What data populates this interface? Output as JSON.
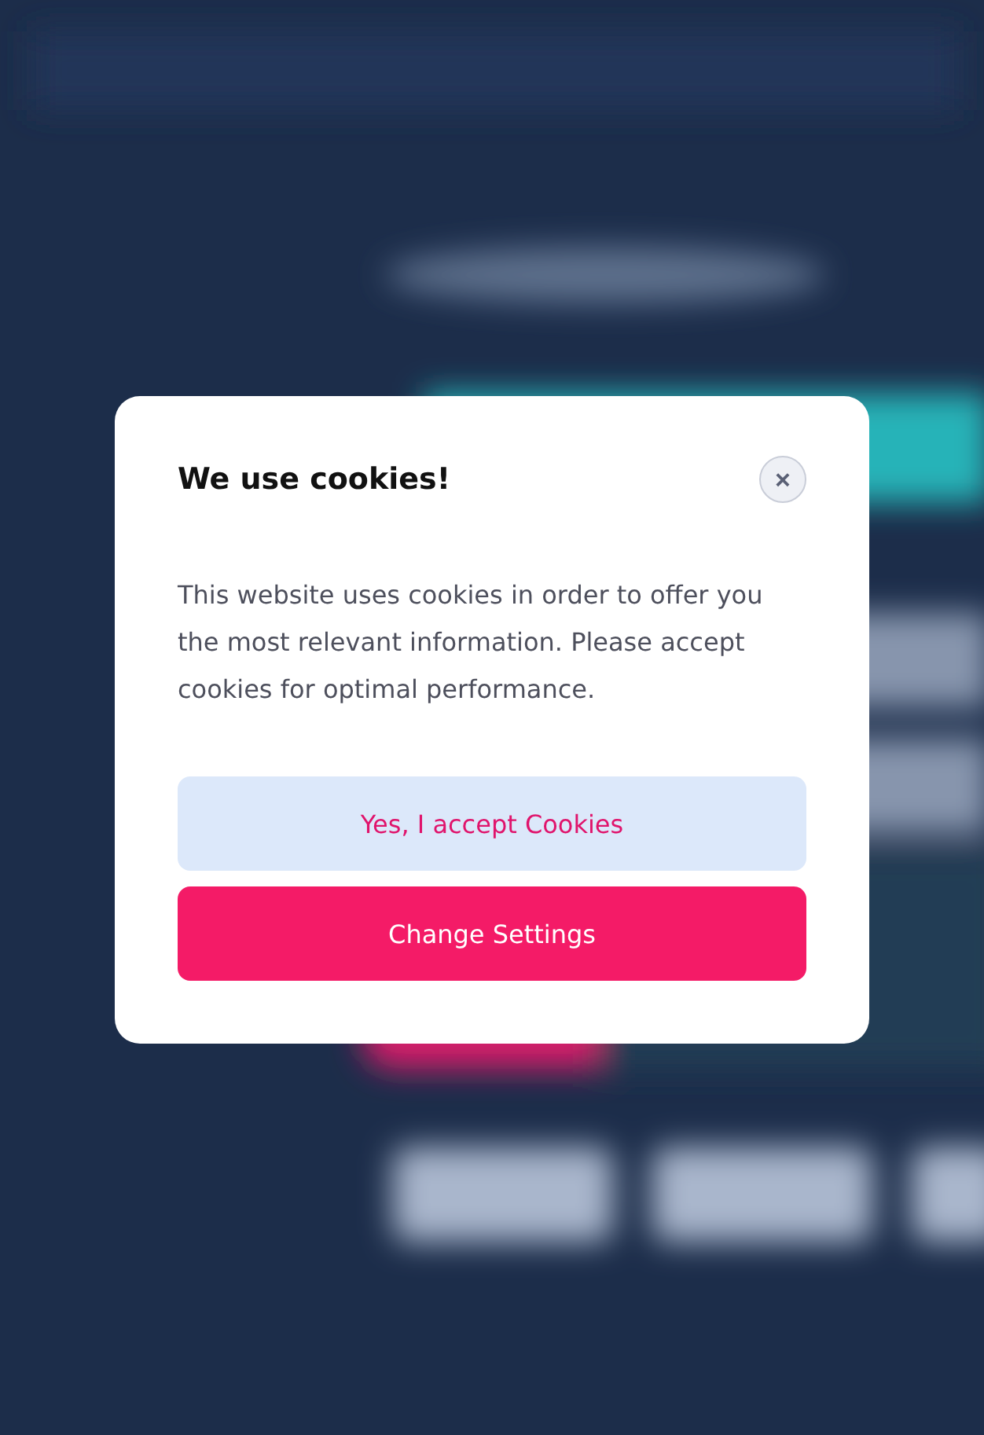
{
  "dialog": {
    "title": "We use cookies!",
    "close_label": "×",
    "message": "This website uses cookies in order to offer you the most relevant information. Please accept cookies for optimal performance.",
    "buttons": [
      {
        "label": "Yes, I accept Cookies",
        "kind": "secondary"
      },
      {
        "label": "Change Settings",
        "kind": "primary"
      }
    ]
  }
}
